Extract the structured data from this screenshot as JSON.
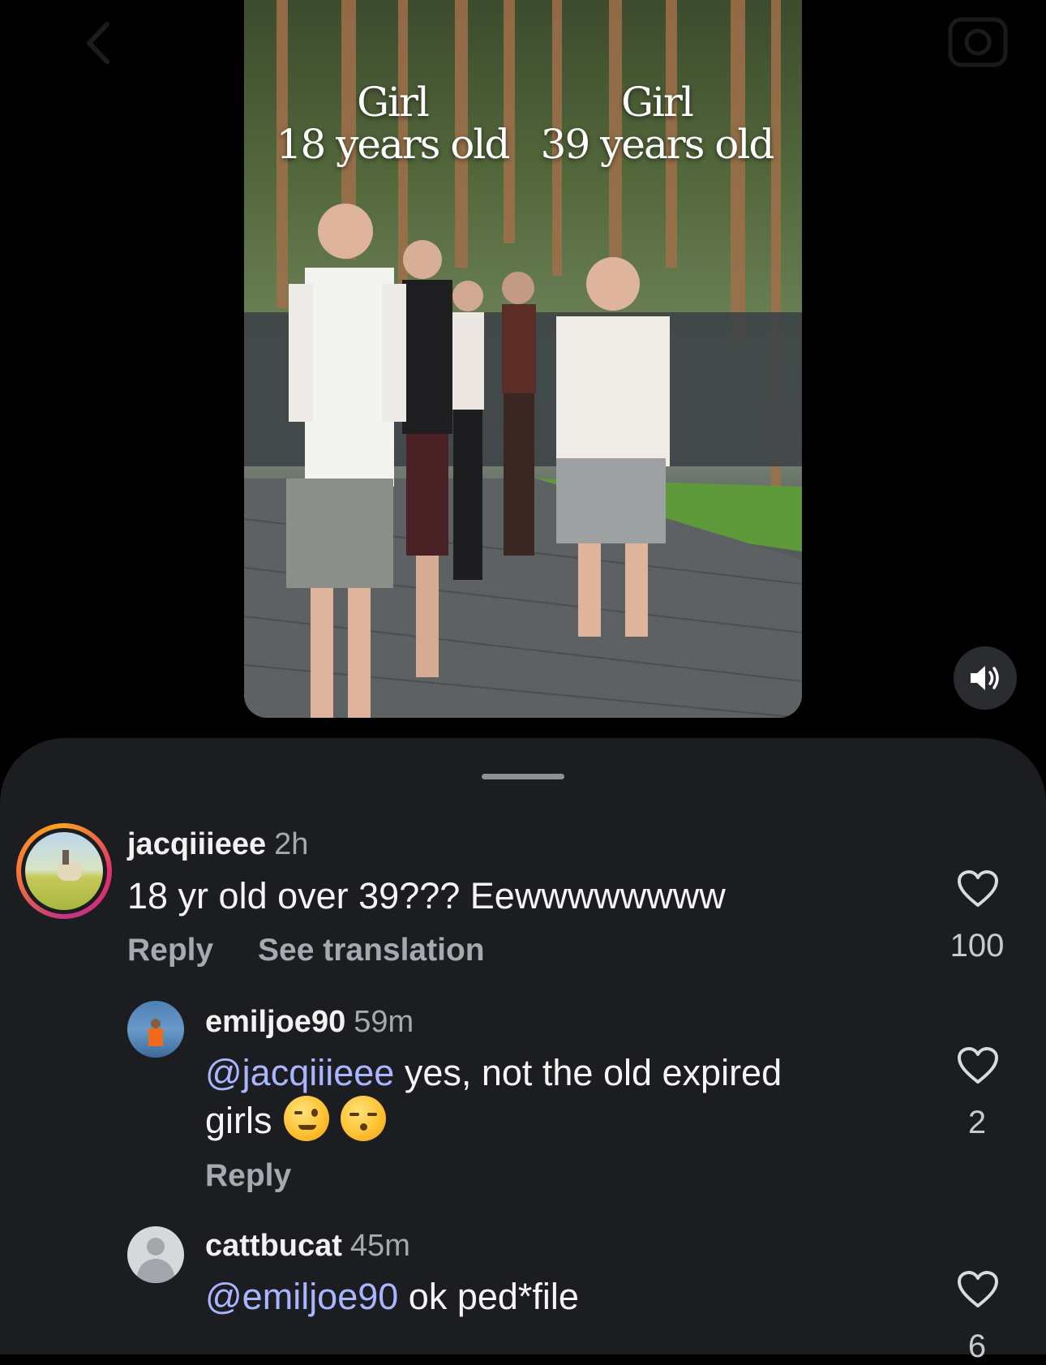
{
  "video": {
    "overlay_left": {
      "line1": "Girl",
      "line2": "18 years old"
    },
    "overlay_right": {
      "line1": "Girl",
      "line2": "39 years old"
    }
  },
  "icons": {
    "back": "chevron-left-icon",
    "camera": "camera-icon",
    "sound": "speaker-on-icon",
    "like": "heart-outline-icon"
  },
  "comments": [
    {
      "username": "jacqiiieee",
      "time": "2h",
      "text": "18 yr old over 39??? Eewwwwwwww",
      "reply_label": "Reply",
      "translation_label": "See translation",
      "likes": "100"
    },
    {
      "username": "emiljoe90",
      "time": "59m",
      "mention": "@jacqiiieee",
      "text_line1": " yes, not the old expired",
      "text_line2": "girls",
      "emojis": [
        "winking-face",
        "kissing-face-closed-eyes"
      ],
      "reply_label": "Reply",
      "likes": "2"
    },
    {
      "username": "cattbucat",
      "time": "45m",
      "mention": "@emiljoe90",
      "text": " ok ped*file",
      "likes": "6"
    }
  ],
  "colors": {
    "sheet_bg": "#1b1d21",
    "mention": "#a9b6ff",
    "secondary_text": "#a6a9b0"
  }
}
